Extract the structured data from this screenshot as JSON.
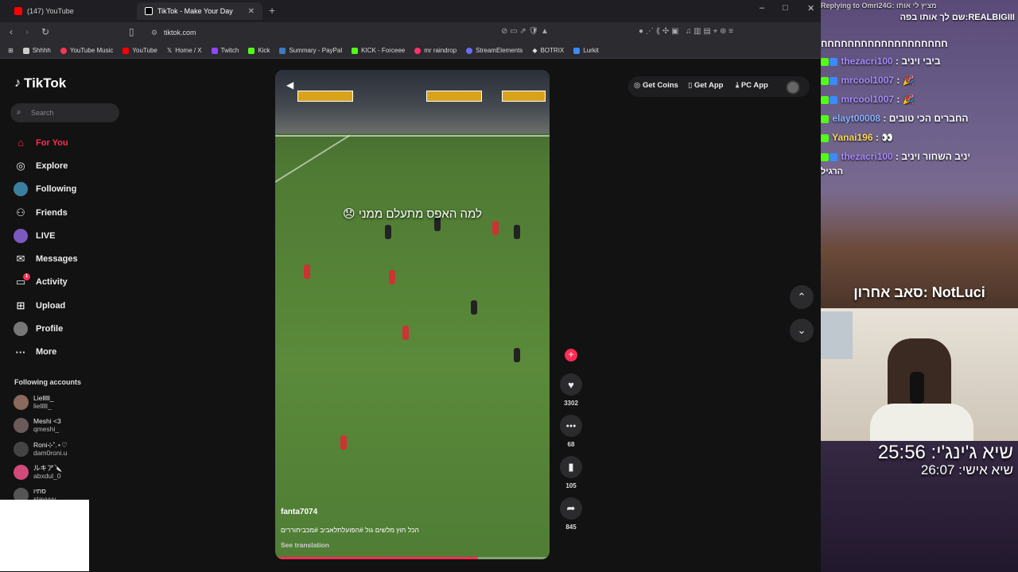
{
  "browser": {
    "tabs": [
      {
        "label": "(147) YouTube",
        "active": false,
        "favicon_color": "#ff0000"
      },
      {
        "label": "TikTok - Make Your Day",
        "active": true,
        "favicon_color": "#000000"
      }
    ],
    "url": "tiktok.com",
    "window_controls": [
      "–",
      "□",
      "✕"
    ],
    "bookmarks": [
      {
        "label": "Shhhh",
        "icon": "folder-icon",
        "color": "#cccccc"
      },
      {
        "label": "YouTube Music",
        "icon": "youtube-music-icon",
        "color": "#ff3355"
      },
      {
        "label": "YouTube",
        "icon": "youtube-icon",
        "color": "#ff0000"
      },
      {
        "label": "Home / X",
        "icon": "x-icon",
        "color": "#ffffff"
      },
      {
        "label": "Twitch",
        "icon": "twitch-icon",
        "color": "#9146ff"
      },
      {
        "label": "Kick",
        "icon": "kick-icon",
        "color": "#53fc18"
      },
      {
        "label": "Summary - PayPal",
        "icon": "paypal-icon",
        "color": "#3b7bbf"
      },
      {
        "label": "KICK - Forceee",
        "icon": "kick-icon",
        "color": "#53fc18"
      },
      {
        "label": "mr raindrop",
        "icon": "raindrop-icon",
        "color": "#ff3366"
      },
      {
        "label": "StreamElements",
        "icon": "streamelements-icon",
        "color": "#6b6bff"
      },
      {
        "label": "BOTRIX",
        "icon": "botrix-icon",
        "color": "#ffffff"
      },
      {
        "label": "Lurkit",
        "icon": "lurkit-icon",
        "color": "#3b8bff"
      }
    ]
  },
  "tiktok": {
    "logo": "TikTok",
    "search_placeholder": "Search",
    "nav": [
      {
        "label": "For You",
        "icon": "home-icon",
        "glyph": "⌂",
        "active": true
      },
      {
        "label": "Explore",
        "icon": "compass-icon",
        "glyph": "◎",
        "active": false
      },
      {
        "label": "Following",
        "icon": "following-avatar",
        "glyph": "●",
        "active": false
      },
      {
        "label": "Friends",
        "icon": "friends-icon",
        "glyph": "⚇",
        "active": false
      },
      {
        "label": "LIVE",
        "icon": "live-avatar",
        "glyph": "●",
        "active": false
      },
      {
        "label": "Messages",
        "icon": "messages-icon",
        "glyph": "✉",
        "active": false
      },
      {
        "label": "Activity",
        "icon": "activity-icon",
        "glyph": "▭",
        "active": false,
        "badge": "1"
      },
      {
        "label": "Upload",
        "icon": "upload-icon",
        "glyph": "⊞",
        "active": false
      },
      {
        "label": "Profile",
        "icon": "profile-avatar",
        "glyph": "●",
        "active": false
      },
      {
        "label": "More",
        "icon": "more-icon",
        "glyph": "···",
        "active": false
      }
    ],
    "following_title": "Following accounts",
    "following": [
      {
        "name": "Lielllll_",
        "handle": "lielllll_"
      },
      {
        "name": "Meshi <3",
        "handle": "qmeshi_"
      },
      {
        "name": "Roni⊹˚.⋆♡",
        "handle": "dam0roni.u"
      },
      {
        "name": "ルキア🔪",
        "handle": "abxdul_0"
      },
      {
        "name": "סתיו",
        "handle": "stavvvv"
      }
    ],
    "top_buttons": {
      "coins": "Get Coins",
      "app": "Get App",
      "pc": "PC App"
    },
    "video": {
      "overlay_text": "😞 למה האפס מתעלם ממני",
      "username": "fanta7074",
      "caption": "הכל חוץ מלשים גול #הפועלתלאביב #מכביחוררים",
      "see_translation": "See translation",
      "progress_fraction": 0.74
    },
    "actions": [
      {
        "icon": "heart-icon",
        "glyph": "♥",
        "count": "3302"
      },
      {
        "icon": "comment-icon",
        "glyph": "●●●",
        "count": "68"
      },
      {
        "icon": "bookmark-icon",
        "glyph": "▮",
        "count": "105"
      },
      {
        "icon": "share-icon",
        "glyph": "➦",
        "count": "845"
      }
    ]
  },
  "stream": {
    "reply_header": "Replying to Omri24G: מציץ לי אותו",
    "reply_line": "שם לך אותו בפה:REALBIGIII",
    "chat_top": "חחחחחחחחחחחחחחחחחחח",
    "chat": [
      {
        "user": "thezacri100",
        "message": "ביבי ויניב",
        "color": "#a78bfa"
      },
      {
        "user": "mrcool1007",
        "message": "🎉",
        "color": "#a78bfa"
      },
      {
        "user": "mrcool1007",
        "message": "🎉",
        "color": "#a78bfa"
      },
      {
        "user": "elayt00008",
        "message": "החברים הכי טובים",
        "color": "#8ab4ff"
      },
      {
        "user": "Yanai196",
        "message": "👀",
        "color": "#ffd95a"
      },
      {
        "user": "thezacri100",
        "message": "יניב השחור ויניב",
        "color": "#a78bfa"
      }
    ],
    "chat_tail": "הרגיל",
    "last_sub": "סאב אחרון: NotLuci",
    "timer_main": "שיא ג'ינג'י: 25:56",
    "timer_personal": "שיא אישי: 26:07"
  }
}
